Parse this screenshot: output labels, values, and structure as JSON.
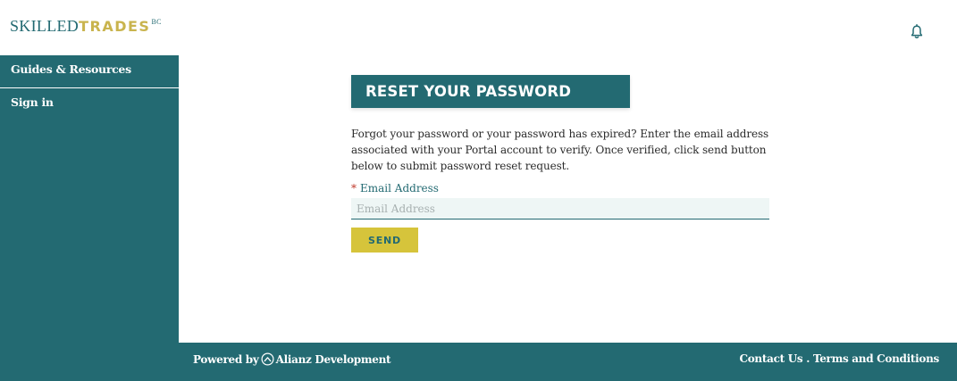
{
  "header": {
    "logo": {
      "part_a": "SKILLED",
      "part_b": "TRADES",
      "part_c": "BC"
    },
    "bell_icon": "bell-icon"
  },
  "sidebar": {
    "items": [
      {
        "label": "Guides & Resources"
      },
      {
        "label": "Sign in"
      }
    ]
  },
  "main": {
    "title": "RESET YOUR PASSWORD",
    "description": "Forgot your password or your password has expired? Enter the email address associated with your Portal account to verify. Once verified, click send button below to submit password reset request.",
    "email": {
      "required_mark": "*",
      "label": "Email Address",
      "placeholder": "Email Address",
      "value": ""
    },
    "send_label": "SEND"
  },
  "footer": {
    "powered_prefix": "Powered by",
    "powered_name": "Alianz Development",
    "contact_label": "Contact Us",
    "separator": " . ",
    "terms_label": "Terms and Conditions"
  },
  "colors": {
    "brand_teal": "#236a72",
    "brand_gold": "#c9b44e",
    "button_yellow": "#d6c43b",
    "input_bg": "#eef6f5"
  }
}
